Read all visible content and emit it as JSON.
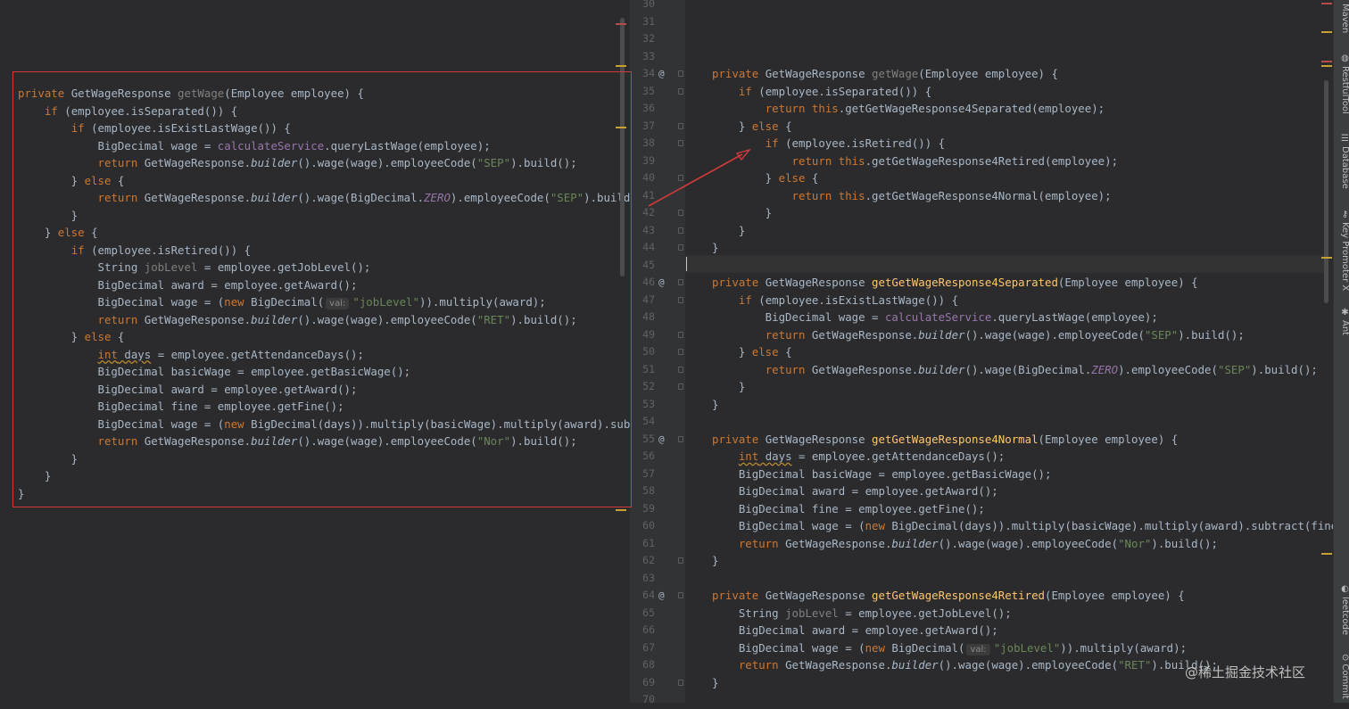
{
  "left_code": [
    [
      [
        "k",
        "private "
      ],
      [
        "",
        "GetWageResponse "
      ],
      [
        "gr",
        "getWage"
      ],
      [
        "",
        "(Employee employee) {"
      ]
    ],
    [
      [
        "",
        "    "
      ],
      [
        "k",
        "if "
      ],
      [
        "",
        "(employee.isSeparated()) {"
      ]
    ],
    [
      [
        "",
        "        "
      ],
      [
        "k",
        "if "
      ],
      [
        "",
        "(employee.isExistLastWage()) {"
      ]
    ],
    [
      [
        "",
        "            BigDecimal wage = "
      ],
      [
        "p",
        "calculateService"
      ],
      [
        "",
        ".queryLastWage(employee);"
      ]
    ],
    [
      [
        "",
        "            "
      ],
      [
        "k",
        "return "
      ],
      [
        "",
        "GetWageResponse."
      ],
      [
        "it",
        "builder"
      ],
      [
        "",
        "().wage(wage).employeeCode("
      ],
      [
        "s",
        "\"SEP\""
      ],
      [
        "",
        ").build();"
      ]
    ],
    [
      [
        "",
        "        } "
      ],
      [
        "k",
        "else "
      ],
      [
        "",
        "{"
      ]
    ],
    [
      [
        "",
        "            "
      ],
      [
        "k",
        "return "
      ],
      [
        "",
        "GetWageResponse."
      ],
      [
        "it",
        "builder"
      ],
      [
        "",
        "().wage(BigDecimal."
      ],
      [
        "i",
        "ZERO"
      ],
      [
        "",
        ").employeeCode("
      ],
      [
        "s",
        "\"SEP\""
      ],
      [
        "",
        ").build"
      ]
    ],
    [
      [
        "",
        "        }"
      ]
    ],
    [
      [
        "",
        "    } "
      ],
      [
        "k",
        "else "
      ],
      [
        "",
        "{"
      ]
    ],
    [
      [
        "",
        "        "
      ],
      [
        "k",
        "if "
      ],
      [
        "",
        "(employee.isRetired()) {"
      ]
    ],
    [
      [
        "",
        "            String "
      ],
      [
        "unused",
        "jobLevel"
      ],
      [
        "",
        " = employee.getJobLevel();"
      ]
    ],
    [
      [
        "",
        "            BigDecimal award = employee.getAward();"
      ]
    ],
    [
      [
        "",
        "            BigDecimal wage = ("
      ],
      [
        "k",
        "new "
      ],
      [
        "",
        "BigDecimal("
      ],
      [
        "hint",
        "val:"
      ],
      [
        "s",
        "\"jobLevel\""
      ],
      [
        "",
        ")).multiply(award);"
      ]
    ],
    [
      [
        "",
        "            "
      ],
      [
        "k",
        "return "
      ],
      [
        "",
        "GetWageResponse."
      ],
      [
        "it",
        "builder"
      ],
      [
        "",
        "().wage(wage).employeeCode("
      ],
      [
        "s",
        "\"RET\""
      ],
      [
        "",
        ").build();"
      ]
    ],
    [
      [
        "",
        "        } "
      ],
      [
        "k",
        "else "
      ],
      [
        "",
        "{"
      ]
    ],
    [
      [
        "",
        "            "
      ],
      [
        "kw",
        "int days = employee.getAttendanceDays();"
      ]
    ],
    [
      [
        "",
        "            BigDecimal basicWage = employee.getBasicWage();"
      ]
    ],
    [
      [
        "",
        "            BigDecimal award = employee.getAward();"
      ]
    ],
    [
      [
        "",
        "            BigDecimal fine = employee.getFine();"
      ]
    ],
    [
      [
        "",
        "            BigDecimal wage = ("
      ],
      [
        "k",
        "new "
      ],
      [
        "",
        "BigDecimal(days)).multiply(basicWage).multiply(award).subt"
      ]
    ],
    [
      [
        "",
        "            "
      ],
      [
        "k",
        "return "
      ],
      [
        "",
        "GetWageResponse."
      ],
      [
        "it",
        "builder"
      ],
      [
        "",
        "().wage(wage).employeeCode("
      ],
      [
        "s",
        "\"Nor\""
      ],
      [
        "",
        ").build();"
      ]
    ],
    [
      [
        "",
        "        }"
      ]
    ],
    [
      [
        "",
        "    }"
      ]
    ],
    [
      [
        "",
        "}"
      ]
    ]
  ],
  "right_lines": [
    "30",
    "31",
    "32",
    "33",
    "34",
    "35",
    "36",
    "37",
    "38",
    "39",
    "40",
    "41",
    "42",
    "43",
    "44",
    "45",
    "46",
    "47",
    "48",
    "49",
    "50",
    "51",
    "52",
    "53",
    "54",
    "55",
    "56",
    "57",
    "58",
    "59",
    "60",
    "61",
    "62",
    "63",
    "64",
    "65",
    "66",
    "67",
    "68",
    "69",
    "70"
  ],
  "right_code": [
    [],
    [],
    [],
    [],
    [
      [
        "k",
        "private "
      ],
      [
        "",
        "GetWageResponse "
      ],
      [
        "gr",
        "getWage"
      ],
      [
        "",
        "(Employee employee) {"
      ]
    ],
    [
      [
        "",
        "    "
      ],
      [
        "k",
        "if "
      ],
      [
        "",
        "(employee.isSeparated()) {"
      ]
    ],
    [
      [
        "",
        "        "
      ],
      [
        "k",
        "return this"
      ],
      [
        "",
        ".getGetWageResponse4Separated(employee);"
      ]
    ],
    [
      [
        "",
        "    } "
      ],
      [
        "k",
        "else "
      ],
      [
        "",
        "{"
      ]
    ],
    [
      [
        "",
        "        "
      ],
      [
        "k",
        "if "
      ],
      [
        "",
        "(employee.isRetired()) {"
      ]
    ],
    [
      [
        "",
        "            "
      ],
      [
        "k",
        "return this"
      ],
      [
        "",
        ".getGetWageResponse4Retired(employee);"
      ]
    ],
    [
      [
        "",
        "        } "
      ],
      [
        "k",
        "else "
      ],
      [
        "",
        "{"
      ]
    ],
    [
      [
        "",
        "            "
      ],
      [
        "k",
        "return this"
      ],
      [
        "",
        ".getGetWageResponse4Normal(employee);"
      ]
    ],
    [
      [
        "",
        "        }"
      ]
    ],
    [
      [
        "",
        "    }"
      ]
    ],
    [
      [
        "",
        "}"
      ]
    ],
    [],
    [
      [
        "k",
        "private "
      ],
      [
        "",
        "GetWageResponse "
      ],
      [
        "m",
        "getGetWageResponse4Separated"
      ],
      [
        "",
        "(Employee employee) {"
      ]
    ],
    [
      [
        "",
        "    "
      ],
      [
        "k",
        "if "
      ],
      [
        "",
        "(employee.isExistLastWage()) {"
      ]
    ],
    [
      [
        "",
        "        BigDecimal wage = "
      ],
      [
        "p",
        "calculateService"
      ],
      [
        "",
        ".queryLastWage(employee);"
      ]
    ],
    [
      [
        "",
        "        "
      ],
      [
        "k",
        "return "
      ],
      [
        "",
        "GetWageResponse."
      ],
      [
        "it",
        "builder"
      ],
      [
        "",
        "().wage(wage).employeeCode("
      ],
      [
        "s",
        "\"SEP\""
      ],
      [
        "",
        ").build();"
      ]
    ],
    [
      [
        "",
        "    } "
      ],
      [
        "k",
        "else "
      ],
      [
        "",
        "{"
      ]
    ],
    [
      [
        "",
        "        "
      ],
      [
        "k",
        "return "
      ],
      [
        "",
        "GetWageResponse."
      ],
      [
        "it",
        "builder"
      ],
      [
        "",
        "().wage(BigDecimal."
      ],
      [
        "i",
        "ZERO"
      ],
      [
        "",
        ").employeeCode("
      ],
      [
        "s",
        "\"SEP\""
      ],
      [
        "",
        ").build();"
      ]
    ],
    [
      [
        "",
        "    }"
      ]
    ],
    [
      [
        "",
        "}"
      ]
    ],
    [],
    [
      [
        "k",
        "private "
      ],
      [
        "",
        "GetWageResponse "
      ],
      [
        "m",
        "getGetWageResponse4Normal"
      ],
      [
        "",
        "(Employee employee) {"
      ]
    ],
    [
      [
        "",
        "    "
      ],
      [
        "kw",
        "int days = employee.getAttendanceDays();"
      ]
    ],
    [
      [
        "",
        "    BigDecimal basicWage = employee.getBasicWage();"
      ]
    ],
    [
      [
        "",
        "    BigDecimal award = employee.getAward();"
      ]
    ],
    [
      [
        "",
        "    BigDecimal fine = employee.getFine();"
      ]
    ],
    [
      [
        "",
        "    BigDecimal wage = ("
      ],
      [
        "k",
        "new "
      ],
      [
        "",
        "BigDecimal(days)).multiply(basicWage).multiply(award).subtract(fine"
      ]
    ],
    [
      [
        "",
        "    "
      ],
      [
        "k",
        "return "
      ],
      [
        "",
        "GetWageResponse."
      ],
      [
        "it",
        "builder"
      ],
      [
        "",
        "().wage(wage).employeeCode("
      ],
      [
        "s",
        "\"Nor\""
      ],
      [
        "",
        ").build();"
      ]
    ],
    [
      [
        "",
        "}"
      ]
    ],
    [],
    [
      [
        "k",
        "private "
      ],
      [
        "",
        "GetWageResponse "
      ],
      [
        "m",
        "getGetWageResponse4Retired"
      ],
      [
        "",
        "(Employee employee) {"
      ]
    ],
    [
      [
        "",
        "    String "
      ],
      [
        "unused",
        "jobLevel"
      ],
      [
        "",
        " = employee.getJobLevel();"
      ]
    ],
    [
      [
        "",
        "    BigDecimal award = employee.getAward();"
      ]
    ],
    [
      [
        "",
        "    BigDecimal wage = ("
      ],
      [
        "k",
        "new "
      ],
      [
        "",
        "BigDecimal("
      ],
      [
        "hint",
        "val:"
      ],
      [
        "s",
        "\"jobLevel\""
      ],
      [
        "",
        ")).multiply(award);"
      ]
    ],
    [
      [
        "",
        "    "
      ],
      [
        "k",
        "return "
      ],
      [
        "",
        "GetWageResponse."
      ],
      [
        "it",
        "builder"
      ],
      [
        "",
        "().wage(wage).employeeCode("
      ],
      [
        "s",
        "\"RET\""
      ],
      [
        "",
        ").build();"
      ]
    ],
    [
      [
        "",
        "}"
      ]
    ],
    []
  ],
  "override_lines": [
    "34",
    "46",
    "55",
    "64"
  ],
  "tool_windows": [
    {
      "label": "Maven",
      "icon": "m-icon"
    },
    {
      "label": "RestfulTool",
      "icon": "globe-icon"
    },
    {
      "label": "Database",
      "icon": "database-icon"
    },
    {
      "label": "Key Promoter X",
      "icon": "key-icon"
    },
    {
      "label": "Ant",
      "icon": "ant-icon"
    },
    {
      "label": "leetcode",
      "icon": "leetcode-icon"
    },
    {
      "label": "Commit",
      "icon": "commit-icon"
    }
  ],
  "watermark": "@稀土掘金技术社区",
  "colors": {
    "highlight_box": "#d23a3a",
    "keyword": "#cc7832",
    "method": "#ffc66d",
    "string": "#6a8759",
    "field": "#9876aa"
  }
}
